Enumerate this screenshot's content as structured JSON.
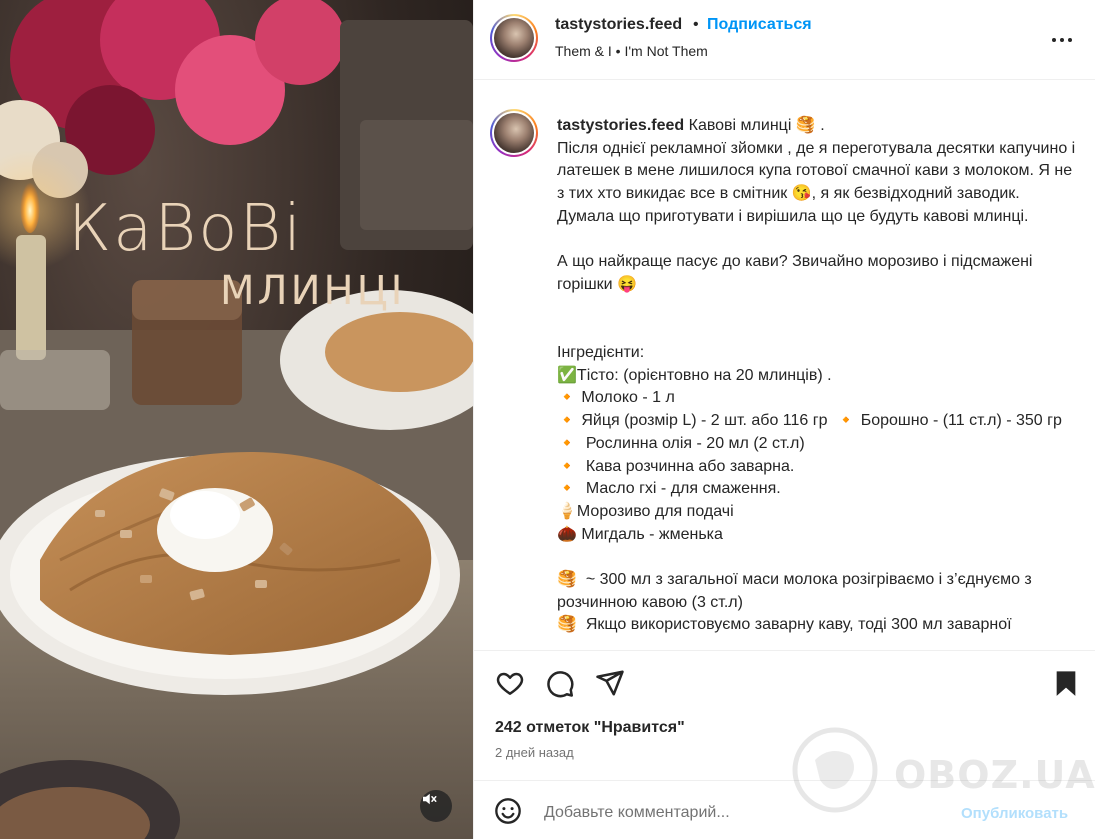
{
  "media": {
    "title_line1": "КаВоВі",
    "title_line2": "МЛИНЦІ",
    "mute_icon": "speaker-muted-icon"
  },
  "header": {
    "username": "tastystories.feed",
    "separator": "•",
    "follow_label": "Подписаться",
    "audio": "Them & I • I'm Not Them"
  },
  "caption": {
    "author": "tastystories.feed",
    "text": " Кавові млинці 🥞 .\nПісля однієї рекламної зйомки , де я переготувала десятки капучино і латешек в мене лишилося купа готової смачної кави з молоком. Я не з тих хто викидає все в смітник 😘, я як безвідходний заводик.\nДумала що приготувати і вирішила що це будуть кавові млинці.\n\nА що найкраще пасує до кави? Звичайно морозиво і підсмажені горішки 😝\n\n\nІнгредієнти:\n✅Тісто: (орієнтовно на 20 млинців) .\n🔸 Молоко - 1 л\n🔸 Яйця (розмір L) - 2 шт. або 116 гр  🔸 Борошно - (11 ст.л) - 350 гр\n🔸  Рослинна олія - 20 мл (2 ст.л)\n🔸  Кава розчинна або заварна.\n🔸  Масло гхі - для смаження.\n🍦Морозиво для подачі\n🌰 Мигдаль - жменька\n\n🥞  ~ 300 мл з загальної маси молока розігріваємо і з’єднуємо з розчинною кавою (3 ст.л)\n🥞  Якщо використовуємо заварну каву, тоді 300 мл заварної"
  },
  "actions": {
    "like_icon": "heart-icon",
    "comment_icon": "comment-icon",
    "share_icon": "share-icon",
    "save_icon": "bookmark-icon"
  },
  "likes": "242 отметок \"Нравится\"",
  "time_ago": "2 дней назад",
  "comment": {
    "emoji_icon": "emoji-icon",
    "placeholder": "Добавьте комментарий...",
    "publish_label": "Опубликовать"
  },
  "watermark": {
    "text": "OBOZ.UA"
  },
  "colors": {
    "accent": "#0095f6",
    "publish_disabled": "#b2dffc",
    "muted_text": "#737373",
    "border": "#efefef"
  }
}
